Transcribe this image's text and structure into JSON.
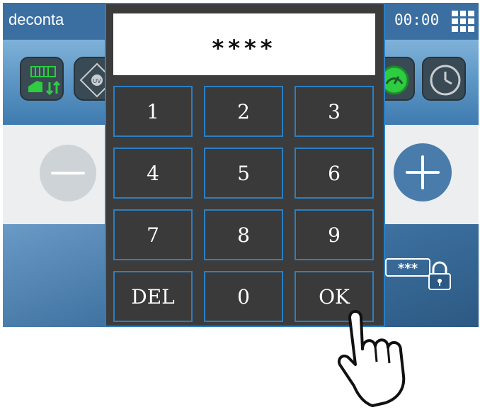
{
  "header": {
    "app_name": "deconta",
    "time": "00:00"
  },
  "keypad": {
    "display": "****",
    "keys": [
      "1",
      "2",
      "3",
      "4",
      "5",
      "6",
      "7",
      "8",
      "9",
      "DEL",
      "0",
      "OK"
    ]
  },
  "colors": {
    "accent": "#2a7fc4",
    "keypad_bg": "#3c3c3c",
    "topbar": "#3b6fa2"
  },
  "icons": [
    "menu-grid-icon",
    "filter-module-icon",
    "uv-lamp-icon",
    "gauge-icon",
    "clock-icon",
    "minus-icon",
    "plus-icon",
    "password-lock-icon",
    "pointing-hand-icon"
  ]
}
